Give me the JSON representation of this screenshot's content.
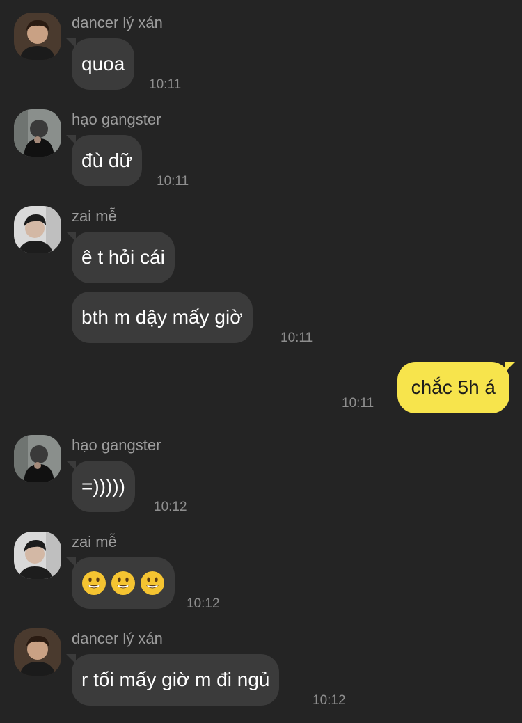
{
  "messages": [
    {
      "sender": "dancer lý xán",
      "avatar": "avatar-dancer",
      "text": "quoa",
      "time": "10:11"
    },
    {
      "sender": "hạo gangster",
      "avatar": "avatar-hao",
      "text": "đù dữ",
      "time": "10:11"
    },
    {
      "sender": "zai mễ",
      "avatar": "avatar-zai",
      "texts": [
        "ê t hỏi cái",
        "bth m dậy mấy giờ"
      ],
      "time": "10:11"
    },
    {
      "sender": "me",
      "text": "chắc 5h á",
      "time": "10:11"
    },
    {
      "sender": "hạo gangster",
      "avatar": "avatar-hao",
      "text": "=)))))",
      "time": "10:12"
    },
    {
      "sender": "zai mễ",
      "avatar": "avatar-zai",
      "emoji": [
        "smiley-emoji",
        "smiley-emoji",
        "smiley-emoji"
      ],
      "time": "10:12"
    },
    {
      "sender": "dancer lý xán",
      "avatar": "avatar-dancer",
      "text": "r tối mấy giờ m đi ngủ",
      "time": "10:12"
    }
  ],
  "colors": {
    "background": "#242424",
    "incoming_bubble": "#3b3b3b",
    "outgoing_bubble": "#f7e44c",
    "sender_name": "#9d9d9d",
    "timestamp": "#8e8e8e"
  }
}
